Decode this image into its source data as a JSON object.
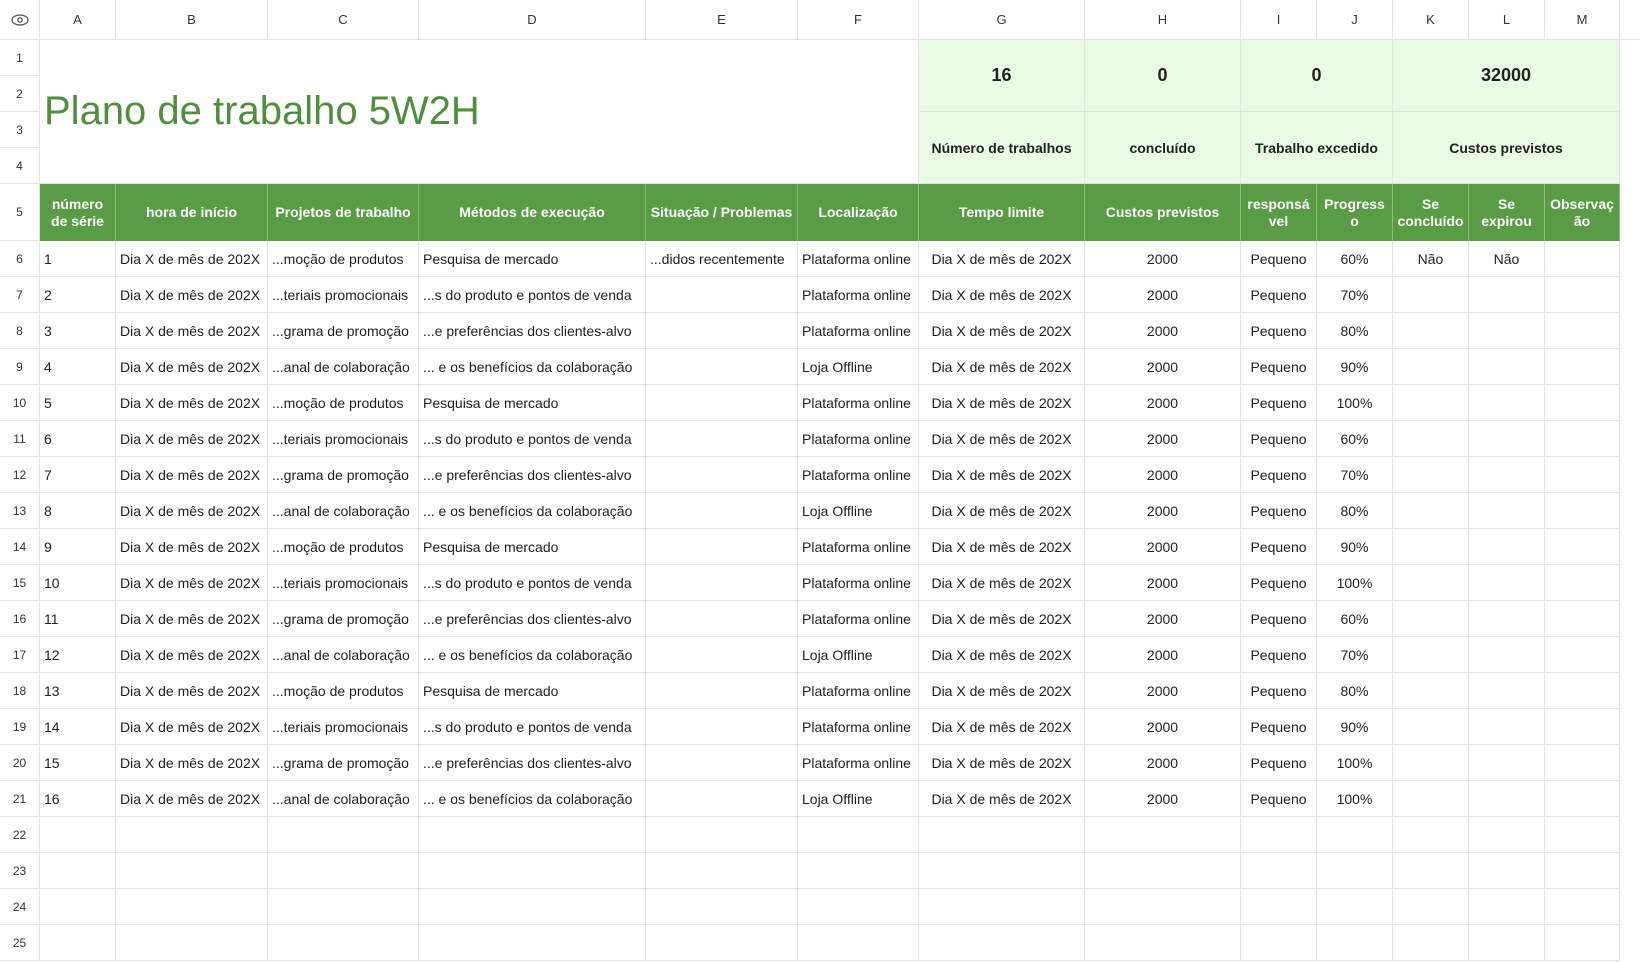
{
  "columns": [
    "A",
    "B",
    "C",
    "D",
    "E",
    "F",
    "G",
    "H",
    "I",
    "J",
    "K",
    "L",
    "M"
  ],
  "row_numbers": [
    "1",
    "2",
    "3",
    "4",
    "5",
    "6",
    "7",
    "8",
    "9",
    "10",
    "11",
    "12",
    "13",
    "14",
    "15",
    "16",
    "17",
    "18",
    "19",
    "20",
    "21",
    "22",
    "23",
    "24",
    "25"
  ],
  "title": "Plano de trabalho 5W2H",
  "stats": [
    {
      "value": "16",
      "label": "Número de trabalhos"
    },
    {
      "value": "0",
      "label": "concluído"
    },
    {
      "value": "0",
      "label": "Trabalho excedido"
    },
    {
      "value": "32000",
      "label": "Custos previstos"
    }
  ],
  "headers": [
    "número de série",
    "hora de início",
    "Projetos de trabalho",
    "Métodos de execução",
    "Situação / Problemas",
    "Localização",
    "Tempo limite",
    "Custos previstos",
    "responsá vel",
    "Progress o",
    "Se concluído",
    "Se expirou",
    "Observaç ão"
  ],
  "rows": [
    [
      "1",
      "Dia X de mês de 202X",
      "...moção de produtos",
      "Pesquisa de mercado",
      "...didos recentemente",
      "Plataforma online",
      "Dia X de mês de 202X",
      "2000",
      "Pequeno",
      "60%",
      "Não",
      "Não",
      ""
    ],
    [
      "2",
      "Dia X de mês de 202X",
      "...teriais promocionais",
      "...s do produto e pontos de venda",
      "",
      "Plataforma online",
      "Dia X de mês de 202X",
      "2000",
      "Pequeno",
      "70%",
      "",
      "",
      ""
    ],
    [
      "3",
      "Dia X de mês de 202X",
      "...grama de promoção",
      "...e preferências dos clientes-alvo",
      "",
      "Plataforma online",
      "Dia X de mês de 202X",
      "2000",
      "Pequeno",
      "80%",
      "",
      "",
      ""
    ],
    [
      "4",
      "Dia X de mês de 202X",
      "...anal de colaboração",
      "... e os benefícios da colaboração",
      "",
      "Loja Offline",
      "Dia X de mês de 202X",
      "2000",
      "Pequeno",
      "90%",
      "",
      "",
      ""
    ],
    [
      "5",
      "Dia X de mês de 202X",
      "...moção de produtos",
      "Pesquisa de mercado",
      "",
      "Plataforma online",
      "Dia X de mês de 202X",
      "2000",
      "Pequeno",
      "100%",
      "",
      "",
      ""
    ],
    [
      "6",
      "Dia X de mês de 202X",
      "...teriais promocionais",
      "...s do produto e pontos de venda",
      "",
      "Plataforma online",
      "Dia X de mês de 202X",
      "2000",
      "Pequeno",
      "60%",
      "",
      "",
      ""
    ],
    [
      "7",
      "Dia X de mês de 202X",
      "...grama de promoção",
      "...e preferências dos clientes-alvo",
      "",
      "Plataforma online",
      "Dia X de mês de 202X",
      "2000",
      "Pequeno",
      "70%",
      "",
      "",
      ""
    ],
    [
      "8",
      "Dia X de mês de 202X",
      "...anal de colaboração",
      "... e os benefícios da colaboração",
      "",
      "Loja Offline",
      "Dia X de mês de 202X",
      "2000",
      "Pequeno",
      "80%",
      "",
      "",
      ""
    ],
    [
      "9",
      "Dia X de mês de 202X",
      "...moção de produtos",
      "Pesquisa de mercado",
      "",
      "Plataforma online",
      "Dia X de mês de 202X",
      "2000",
      "Pequeno",
      "90%",
      "",
      "",
      ""
    ],
    [
      "10",
      "Dia X de mês de 202X",
      "...teriais promocionais",
      "...s do produto e pontos de venda",
      "",
      "Plataforma online",
      "Dia X de mês de 202X",
      "2000",
      "Pequeno",
      "100%",
      "",
      "",
      ""
    ],
    [
      "11",
      "Dia X de mês de 202X",
      "...grama de promoção",
      "...e preferências dos clientes-alvo",
      "",
      "Plataforma online",
      "Dia X de mês de 202X",
      "2000",
      "Pequeno",
      "60%",
      "",
      "",
      ""
    ],
    [
      "12",
      "Dia X de mês de 202X",
      "...anal de colaboração",
      "... e os benefícios da colaboração",
      "",
      "Loja Offline",
      "Dia X de mês de 202X",
      "2000",
      "Pequeno",
      "70%",
      "",
      "",
      ""
    ],
    [
      "13",
      "Dia X de mês de 202X",
      "...moção de produtos",
      "Pesquisa de mercado",
      "",
      "Plataforma online",
      "Dia X de mês de 202X",
      "2000",
      "Pequeno",
      "80%",
      "",
      "",
      ""
    ],
    [
      "14",
      "Dia X de mês de 202X",
      "...teriais promocionais",
      "...s do produto e pontos de venda",
      "",
      "Plataforma online",
      "Dia X de mês de 202X",
      "2000",
      "Pequeno",
      "90%",
      "",
      "",
      ""
    ],
    [
      "15",
      "Dia X de mês de 202X",
      "...grama de promoção",
      "...e preferências dos clientes-alvo",
      "",
      "Plataforma online",
      "Dia X de mês de 202X",
      "2000",
      "Pequeno",
      "100%",
      "",
      "",
      ""
    ],
    [
      "16",
      "Dia X de mês de 202X",
      "...anal de colaboração",
      "... e os benefícios da colaboração",
      "",
      "Loja Offline",
      "Dia X de mês de 202X",
      "2000",
      "Pequeno",
      "100%",
      "",
      "",
      ""
    ]
  ],
  "colors": {
    "accent": "#5a9b45",
    "title": "#4f8f3b",
    "stat_bg": "#e9fbe4"
  }
}
